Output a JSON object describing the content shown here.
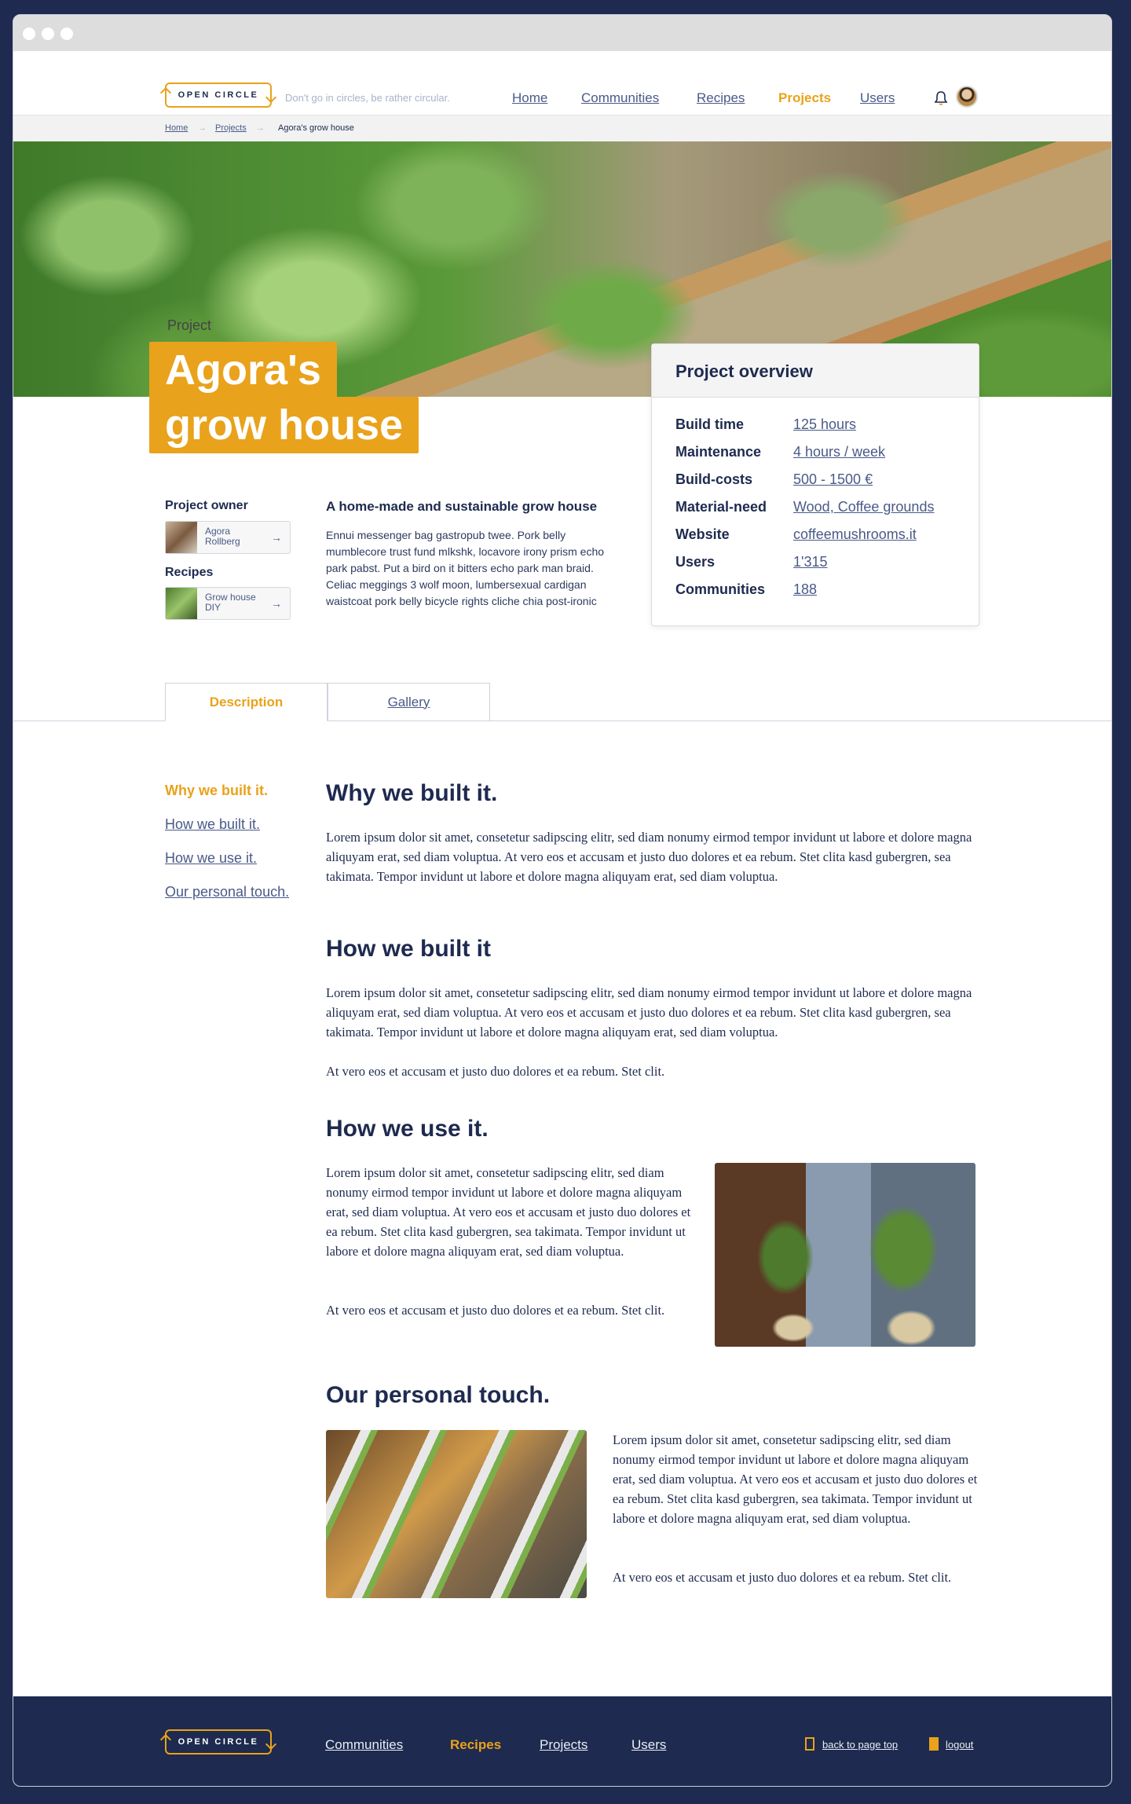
{
  "brand": {
    "logo_text": "OPEN CIRCLE",
    "tagline": "Don't go in circles, be rather circular."
  },
  "nav": {
    "home": "Home",
    "communities": "Communities",
    "recipes": "Recipes",
    "projects": "Projects",
    "users": "Users"
  },
  "breadcrumb": {
    "home": "Home",
    "projects": "Projects",
    "current": "Agora's grow house",
    "separator": "→"
  },
  "hero": {
    "label": "Project",
    "title_line1": "Agora's",
    "title_line2": "grow house"
  },
  "overview": {
    "title": "Project overview",
    "rows": [
      {
        "label": "Build time",
        "value": "125 hours"
      },
      {
        "label": "Maintenance",
        "value": "4 hours / week"
      },
      {
        "label": "Build-costs",
        "value": "500 - 1500 €"
      },
      {
        "label": "Material-need",
        "value": "Wood, Coffee grounds"
      },
      {
        "label": "Website",
        "value": "coffeemushrooms.it"
      },
      {
        "label": "Users",
        "value": "1'315"
      },
      {
        "label": "Communities",
        "value": "188"
      }
    ]
  },
  "owner": {
    "heading": "Project owner",
    "name": "Agora Rollberg"
  },
  "recipes": {
    "heading": "Recipes",
    "name": "Grow house DIY"
  },
  "intro": {
    "heading": "A home-made and sustainable grow house",
    "text": "Ennui messenger bag gastropub twee. Pork belly mumblecore trust fund mlkshk, locavore irony prism echo park pabst. Put a bird on it bitters echo park man braid. Celiac meggings 3 wolf moon, lumbersexual cardigan waistcoat pork belly bicycle rights cliche chia post-ironic"
  },
  "tabs": {
    "description": "Description",
    "gallery": "Gallery"
  },
  "toc": {
    "item1": "Why we built it.",
    "item2": "How we built it.",
    "item3": "How we use it.",
    "item4": "Our personal touch."
  },
  "sections": {
    "why": {
      "heading": "Why we built it.",
      "text": "Lorem ipsum dolor sit amet, consetetur sadipscing elitr, sed diam nonumy eirmod tempor invidunt ut labore et dolore magna aliquyam erat, sed diam voluptua. At vero eos et accusam et justo duo dolores et ea rebum. Stet clita kasd gubergren, sea takimata. Tempor invidunt ut labore et dolore magna aliquyam erat, sed diam voluptua."
    },
    "how_built": {
      "heading": "How we built it",
      "text": "Lorem ipsum dolor sit amet, consetetur sadipscing elitr, sed diam nonumy eirmod tempor invidunt ut labore et dolore magna aliquyam erat, sed diam voluptua. At vero eos et accusam et justo duo dolores et ea rebum. Stet clita kasd gubergren, sea takimata. Tempor invidunt ut labore et dolore magna aliquyam erat, sed diam voluptua.",
      "text2": "At vero eos et accusam et justo duo dolores et ea rebum. Stet clit."
    },
    "how_use": {
      "heading": "How we use it.",
      "text": "Lorem ipsum dolor sit amet, consetetur sadipscing elitr, sed diam nonumy eirmod tempor invidunt ut labore et dolore magna aliquyam erat, sed diam voluptua. At vero eos et accusam et justo duo dolores et ea rebum. Stet clita kasd gubergren, sea takimata. Tempor invidunt ut labore et dolore magna aliquyam erat, sed diam voluptua.",
      "text2": "At vero eos et accusam et justo duo dolores et ea rebum. Stet clit."
    },
    "personal": {
      "heading": "Our personal touch.",
      "text": "Lorem ipsum dolor sit amet, consetetur sadipscing elitr, sed diam nonumy eirmod tempor invidunt ut labore et dolore magna aliquyam erat, sed diam voluptua. At vero eos et accusam et justo duo dolores et ea rebum. Stet clita kasd gubergren, sea takimata. Tempor invidunt ut labore et dolore magna aliquyam erat, sed diam voluptua.",
      "text2": "At vero eos et accusam et justo duo dolores et ea rebum. Stet clit."
    }
  },
  "footer": {
    "logo_text": "OPEN CIRCLE",
    "communities": "Communities",
    "recipes": "Recipes",
    "projects": "Projects",
    "users": "Users",
    "back_to_top": "back to page top",
    "logout": "logout"
  },
  "colors": {
    "accent": "#e9a21b",
    "navy": "#1e2a4f",
    "link": "#4a5a88"
  }
}
